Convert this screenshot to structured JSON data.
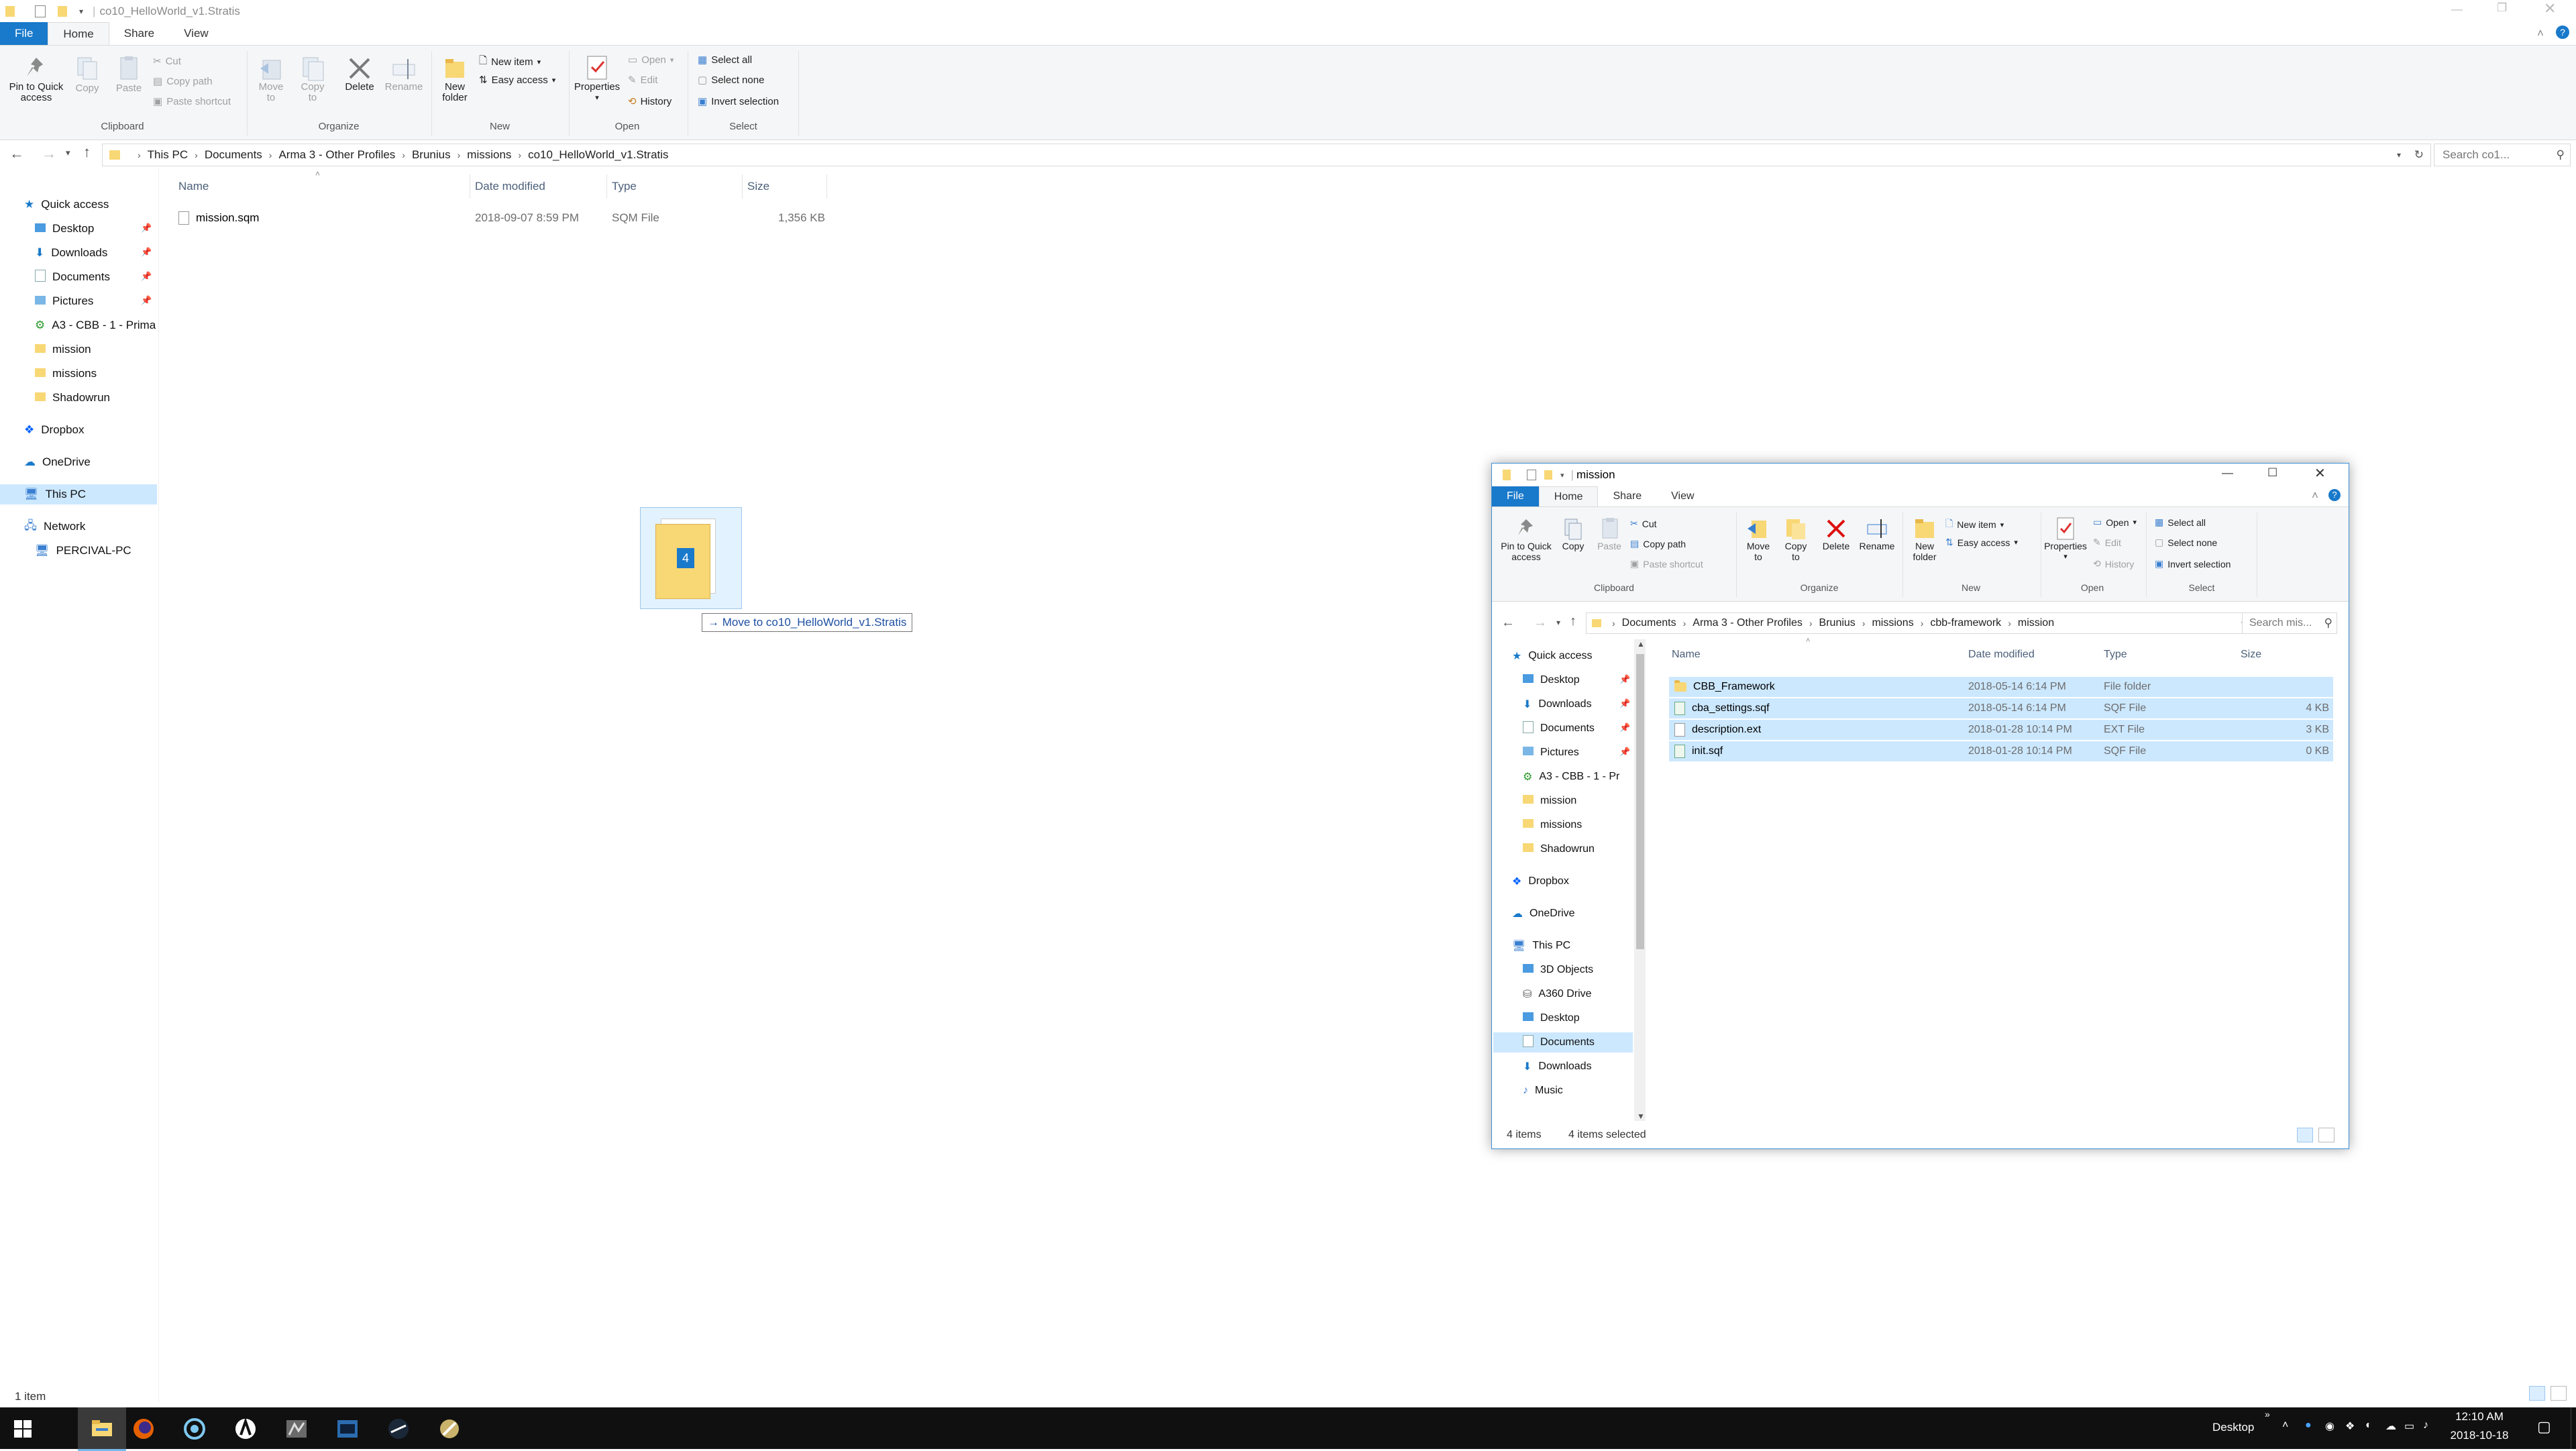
{
  "main": {
    "title": "co10_HelloWorld_v1.Stratis",
    "tabs": [
      "File",
      "Home",
      "Share",
      "View"
    ],
    "ribbon": {
      "clipboard": {
        "pin": "Pin to Quick access",
        "copy": "Copy",
        "paste": "Paste",
        "cut": "Cut",
        "copy_path": "Copy path",
        "paste_shortcut": "Paste shortcut",
        "label": "Clipboard"
      },
      "organize": {
        "move_to": "Move to",
        "copy_to": "Copy to",
        "delete": "Delete",
        "rename": "Rename",
        "label": "Organize"
      },
      "new": {
        "new_folder": "New folder",
        "new_item": "New item",
        "easy_access": "Easy access",
        "label": "New"
      },
      "open": {
        "properties": "Properties",
        "open": "Open",
        "edit": "Edit",
        "history": "History",
        "label": "Open"
      },
      "select": {
        "select_all": "Select all",
        "select_none": "Select none",
        "invert": "Invert selection",
        "label": "Select"
      }
    },
    "address": [
      "This PC",
      "Documents",
      "Arma 3 - Other Profiles",
      "Brunius",
      "missions",
      "co10_HelloWorld_v1.Stratis"
    ],
    "search_placeholder": "Search co1...",
    "nav": [
      {
        "label": "Quick access",
        "kind": "star"
      },
      {
        "label": "Desktop",
        "kind": "folder-blue",
        "pin": true
      },
      {
        "label": "Downloads",
        "kind": "download",
        "pin": true
      },
      {
        "label": "Documents",
        "kind": "doc",
        "pin": true
      },
      {
        "label": "Pictures",
        "kind": "pic",
        "pin": true
      },
      {
        "label": "A3 - CBB - 1 - Prima",
        "kind": "special"
      },
      {
        "label": "mission",
        "kind": "folder"
      },
      {
        "label": "missions",
        "kind": "folder"
      },
      {
        "label": "Shadowrun",
        "kind": "folder"
      },
      {
        "label": "Dropbox",
        "kind": "dropbox"
      },
      {
        "label": "OneDrive",
        "kind": "cloud"
      },
      {
        "label": "This PC",
        "kind": "pc",
        "selected": true
      },
      {
        "label": "Network",
        "kind": "network"
      },
      {
        "label": "PERCIVAL-PC",
        "kind": "pc"
      }
    ],
    "columns": [
      "Name",
      "Date modified",
      "Type",
      "Size"
    ],
    "files": [
      {
        "name": "mission.sqm",
        "date": "2018-09-07 8:59 PM",
        "type": "SQM File",
        "size": "1,356 KB"
      }
    ],
    "status": "1 item"
  },
  "drag": {
    "count": "4",
    "tooltip": "Move to co10_HelloWorld_v1.Stratis"
  },
  "second": {
    "title": "mission",
    "tabs": [
      "File",
      "Home",
      "Share",
      "View"
    ],
    "ribbon": {
      "clipboard": {
        "pin": "Pin to Quick access",
        "copy": "Copy",
        "paste": "Paste",
        "cut": "Cut",
        "copy_path": "Copy path",
        "paste_shortcut": "Paste shortcut",
        "label": "Clipboard"
      },
      "organize": {
        "move_to": "Move to",
        "copy_to": "Copy to",
        "delete": "Delete",
        "rename": "Rename",
        "label": "Organize"
      },
      "new": {
        "new_folder": "New folder",
        "new_item": "New item",
        "easy_access": "Easy access",
        "label": "New"
      },
      "open": {
        "properties": "Properties",
        "open": "Open",
        "edit": "Edit",
        "history": "History",
        "label": "Open"
      },
      "select": {
        "select_all": "Select all",
        "select_none": "Select none",
        "invert": "Invert selection",
        "label": "Select"
      }
    },
    "address": [
      "Documents",
      "Arma 3 - Other Profiles",
      "Brunius",
      "missions",
      "cbb-framework",
      "mission"
    ],
    "search_placeholder": "Search mis...",
    "nav": [
      {
        "label": "Quick access",
        "kind": "star"
      },
      {
        "label": "Desktop",
        "kind": "folder-blue",
        "pin": true
      },
      {
        "label": "Downloads",
        "kind": "download",
        "pin": true
      },
      {
        "label": "Documents",
        "kind": "doc",
        "pin": true
      },
      {
        "label": "Pictures",
        "kind": "pic",
        "pin": true
      },
      {
        "label": "A3 - CBB - 1 - Pr",
        "kind": "special"
      },
      {
        "label": "mission",
        "kind": "folder"
      },
      {
        "label": "missions",
        "kind": "folder"
      },
      {
        "label": "Shadowrun",
        "kind": "folder"
      },
      {
        "label": "Dropbox",
        "kind": "dropbox"
      },
      {
        "label": "OneDrive",
        "kind": "cloud"
      },
      {
        "label": "This PC",
        "kind": "pc"
      },
      {
        "label": "3D Objects",
        "kind": "folder-blue"
      },
      {
        "label": "A360 Drive",
        "kind": "drive"
      },
      {
        "label": "Desktop",
        "kind": "folder-blue"
      },
      {
        "label": "Documents",
        "kind": "doc",
        "selected": true
      },
      {
        "label": "Downloads",
        "kind": "download"
      },
      {
        "label": "Music",
        "kind": "music"
      }
    ],
    "columns": [
      "Name",
      "Date modified",
      "Type",
      "Size"
    ],
    "files": [
      {
        "name": "CBB_Framework",
        "date": "2018-05-14 6:14 PM",
        "type": "File folder",
        "size": "",
        "icon": "folder"
      },
      {
        "name": "cba_settings.sqf",
        "date": "2018-05-14 6:14 PM",
        "type": "SQF File",
        "size": "4 KB",
        "icon": "sqf"
      },
      {
        "name": "description.ext",
        "date": "2018-01-28 10:14 PM",
        "type": "EXT File",
        "size": "3 KB",
        "icon": "doc"
      },
      {
        "name": "init.sqf",
        "date": "2018-01-28 10:14 PM",
        "type": "SQF File",
        "size": "0 KB",
        "icon": "sqf"
      }
    ],
    "status_count": "4 items",
    "status_selected": "4 items selected"
  },
  "taskbar": {
    "desktop_label": "Desktop",
    "time": "12:10 AM",
    "date": "2018-10-18"
  },
  "colors": {
    "accent": "#1979ca",
    "selection": "#cce8ff",
    "taskbar": "#101010"
  }
}
